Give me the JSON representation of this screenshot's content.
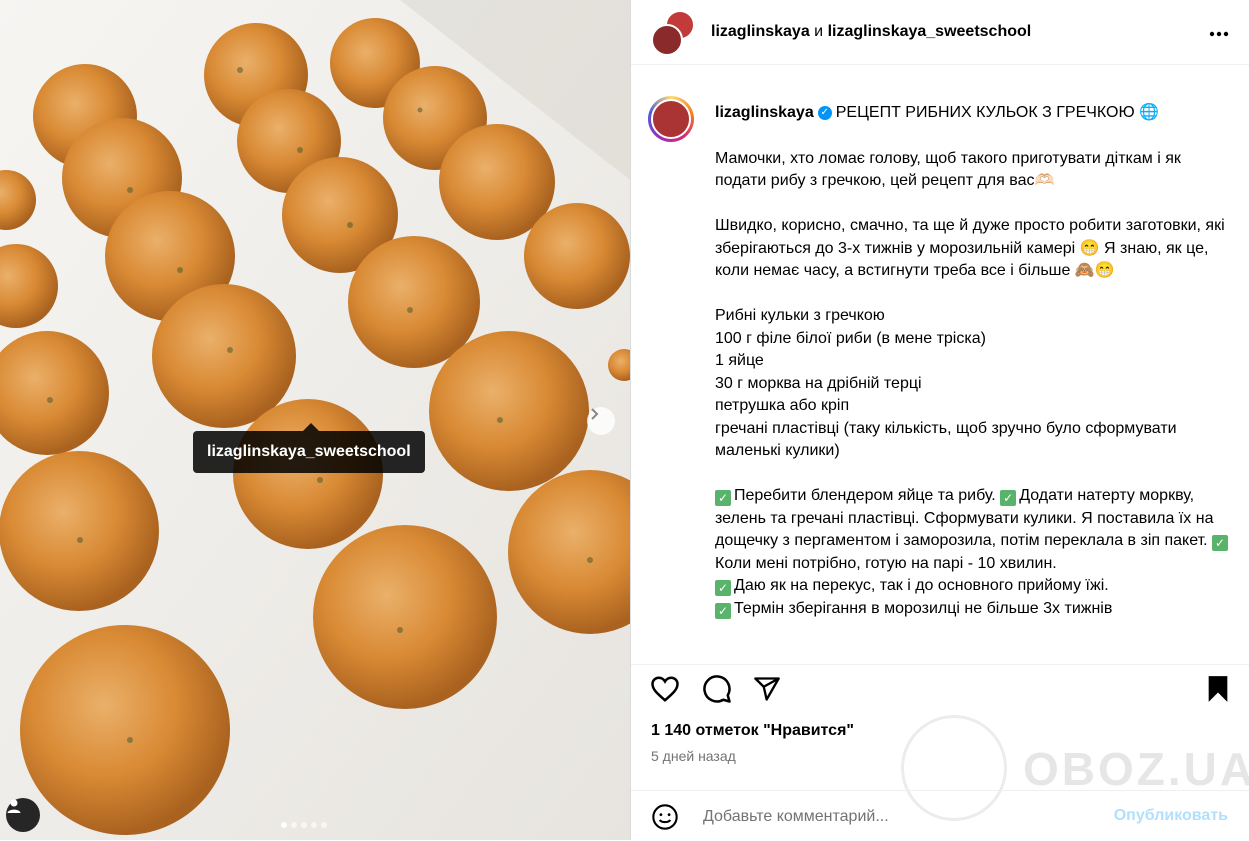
{
  "photo": {
    "user_tag": "lizaglinskaya_sweetschool",
    "carousel_dots": 5,
    "active_dot": 1,
    "colors": {
      "background": "#ece9e4",
      "ball": "#d9892f"
    }
  },
  "header": {
    "user1": "lizaglinskaya",
    "conjunction": "и",
    "user2": "lizaglinskaya_sweetschool",
    "more_icon": "more-horizontal-icon"
  },
  "caption": {
    "username": "lizaglinskaya",
    "title": "РЕЦЕПТ РИБНИХ КУЛЬОК З ГРЕЧКОЮ",
    "paragraphs": [
      "Мамочки, хто ломає голову, щоб такого приготувати діткам і як подати рибу з гречкою, цей рецепт для вас🫶🏻",
      "Швидко, корисно, смачно, та ще й дуже просто робити заготовки, які зберігаються до 3-х тижнів у морозильній камері 😁 Я знаю, як це, коли немає часу, а встигнути треба все і більше 🙈😁"
    ],
    "recipe_lines": [
      "Рибні кульки з гречкою",
      "100 г філе білої риби (в мене тріска)",
      "1 яйце",
      "30 г морква на дрібній терці",
      "петрушка або кріп",
      "гречані пластівці (таку кількість, щоб зручно було сформувати маленькі кулики)"
    ],
    "steps": [
      "Перебити блендером яйце та рибу.",
      "Додати натерту моркву, зелень та гречані пластівці. Сформувати кулики. Я поставила їх на дощечку з пергаментом і заморозила, потім переклала в зіп пакет.",
      "Коли мені потрібно, готую на парі - 10 хвилин.",
      "Даю як на перекус, так і до основного прийому їжі.",
      "Термін зберігання в морозилці не більше 3х тижнів"
    ]
  },
  "actions": {
    "like_icon": "heart-icon",
    "comment_icon": "comment-icon",
    "share_icon": "send-icon",
    "save_icon": "bookmark-icon"
  },
  "likes": "1 140 отметок \"Нравится\"",
  "date": "5 дней назад",
  "watermark": "OBOZ.UA",
  "comment": {
    "placeholder": "Добавьте комментарий...",
    "post_label": "Опубликовать"
  }
}
